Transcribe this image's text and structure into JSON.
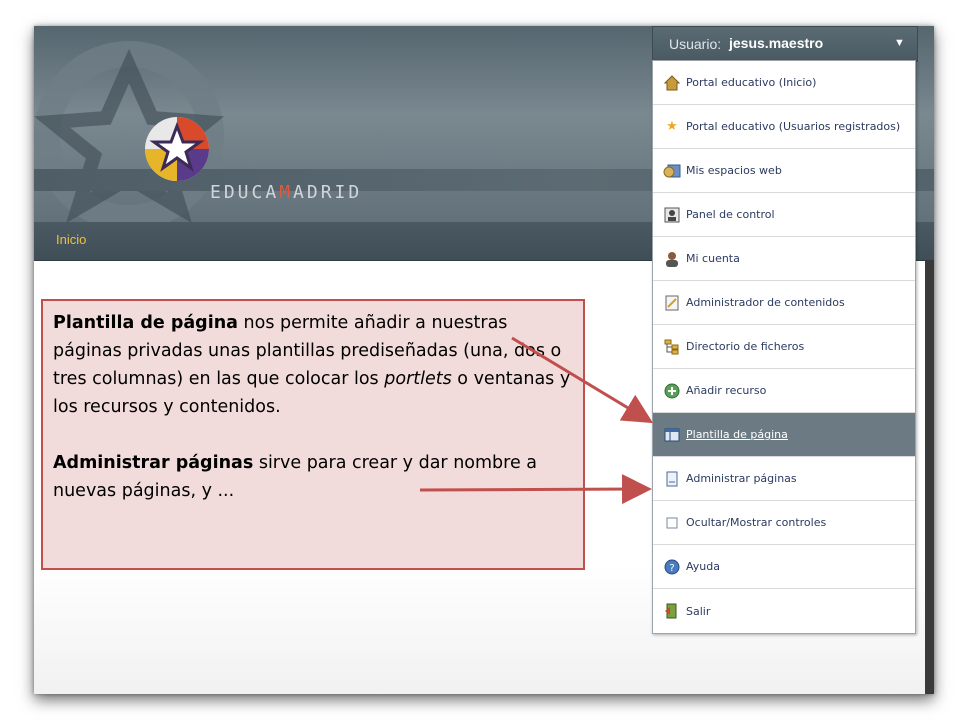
{
  "header": {
    "logo_prefix": "EDUCA",
    "logo_m": "M",
    "logo_suffix": "ADRID",
    "nav_home": "Inicio"
  },
  "user_menu": {
    "label": "Usuario:",
    "username": "jesus.maestro",
    "items": [
      {
        "label": "Portal educativo (Inicio)",
        "icon": "home-icon"
      },
      {
        "label": "Portal educativo (Usuarios registrados)",
        "icon": "star-icon"
      },
      {
        "label": "Mis espacios web",
        "icon": "web-spaces-icon"
      },
      {
        "label": "Panel de control",
        "icon": "control-panel-icon"
      },
      {
        "label": "Mi cuenta",
        "icon": "user-icon"
      },
      {
        "label": "Administrador de contenidos",
        "icon": "content-admin-icon"
      },
      {
        "label": "Directorio de ficheros",
        "icon": "folder-tree-icon"
      },
      {
        "label": "Añadir recurso",
        "icon": "add-icon"
      },
      {
        "label": "Plantilla de página",
        "icon": "page-template-icon",
        "active": true
      },
      {
        "label": "Administrar páginas",
        "icon": "pages-icon"
      },
      {
        "label": "Ocultar/Mostrar controles",
        "icon": "checkbox-icon"
      },
      {
        "label": "Ayuda",
        "icon": "help-icon"
      },
      {
        "label": "Salir",
        "icon": "exit-icon"
      }
    ]
  },
  "callout": {
    "p1_bold": "Plantilla de página",
    "p1_text_a": " nos permite añadir a nuestras páginas privadas unas plantillas prediseñadas (una, dos o tres columnas) en las que colocar los ",
    "p1_italic": "portlets",
    "p1_text_b": " o ventanas y los recursos y contenidos.",
    "p2_bold": "Administrar páginas",
    "p2_text": " sirve para crear y dar nombre a nuevas páginas, y ..."
  },
  "colors": {
    "callout_fill": "#f2dcdb",
    "callout_border": "#c0504d",
    "arrow": "#c0504d",
    "active_item": "#6b7a83"
  }
}
